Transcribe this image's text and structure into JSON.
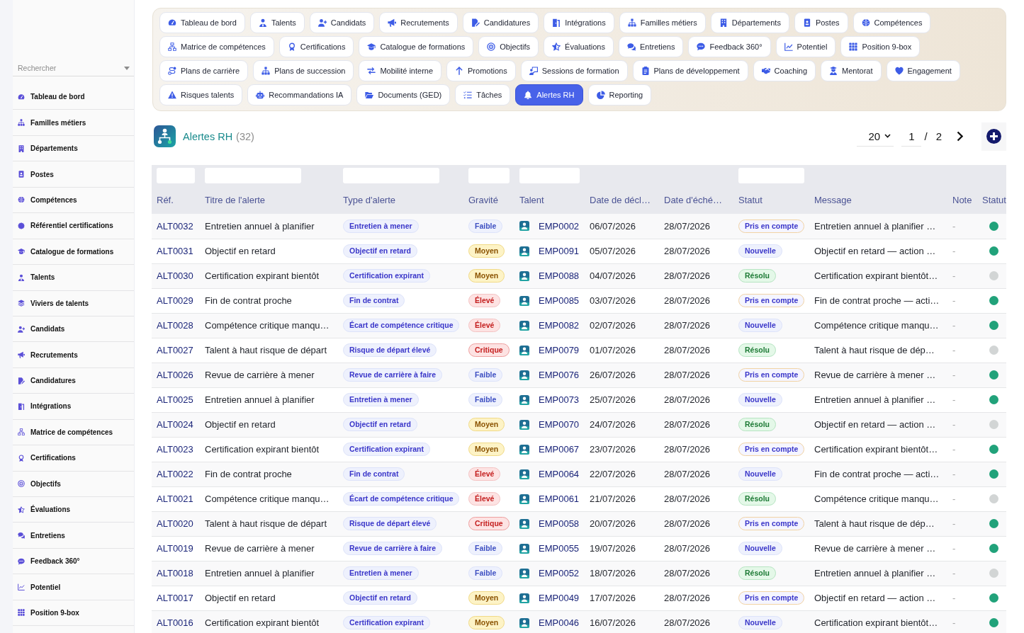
{
  "sidebar": {
    "search": {
      "placeholder": "Rechercher"
    },
    "items": [
      {
        "label": "Tableau de bord"
      },
      {
        "label": "Familles métiers"
      },
      {
        "label": "Départements"
      },
      {
        "label": "Postes"
      },
      {
        "label": "Compétences"
      },
      {
        "label": "Référentiel certifications"
      },
      {
        "label": "Catalogue de formations"
      },
      {
        "label": "Talents"
      },
      {
        "label": "Viviers de talents"
      },
      {
        "label": "Candidats"
      },
      {
        "label": "Recrutements"
      },
      {
        "label": "Candidatures"
      },
      {
        "label": "Intégrations"
      },
      {
        "label": "Matrice de compétences"
      },
      {
        "label": "Certifications"
      },
      {
        "label": "Objectifs"
      },
      {
        "label": "Évaluations"
      },
      {
        "label": "Entretiens"
      },
      {
        "label": "Feedback 360°"
      },
      {
        "label": "Potentiel"
      },
      {
        "label": "Position 9-box"
      }
    ]
  },
  "nav": {
    "rows": [
      {
        "tabs": [
          {
            "label": "Tableau de bord",
            "selected": false
          },
          {
            "label": "Talents",
            "selected": false
          },
          {
            "label": "Candidats",
            "selected": false
          },
          {
            "label": "Recrutements",
            "selected": false
          },
          {
            "label": "Candidatures",
            "selected": false
          },
          {
            "label": "Intégrations",
            "selected": false
          },
          {
            "label": "Familles métiers",
            "selected": false
          },
          {
            "label": "Départements",
            "selected": false
          },
          {
            "label": "Postes",
            "selected": false
          },
          {
            "label": "Compétences",
            "selected": false
          }
        ]
      },
      {
        "tabs": [
          {
            "label": "Matrice de compétences",
            "selected": false
          },
          {
            "label": "Certifications",
            "selected": false
          },
          {
            "label": "Catalogue de formations",
            "selected": false
          },
          {
            "label": "Objectifs",
            "selected": false
          },
          {
            "label": "Évaluations",
            "selected": false
          },
          {
            "label": "Entretiens",
            "selected": false
          },
          {
            "label": "Feedback 360°",
            "selected": false
          },
          {
            "label": "Potentiel",
            "selected": false
          },
          {
            "label": "Position 9-box",
            "selected": false
          }
        ]
      },
      {
        "tabs": [
          {
            "label": "Plans de carrière",
            "selected": false
          },
          {
            "label": "Plans de succession",
            "selected": false
          },
          {
            "label": "Mobilité interne",
            "selected": false
          },
          {
            "label": "Promotions",
            "selected": false
          },
          {
            "label": "Sessions de formation",
            "selected": false
          },
          {
            "label": "Plans de développement",
            "selected": false
          },
          {
            "label": "Coaching",
            "selected": false
          },
          {
            "label": "Mentorat",
            "selected": false
          },
          {
            "label": "Engagement",
            "selected": false
          }
        ]
      },
      {
        "tabs": [
          {
            "label": "Risques talents",
            "selected": false
          },
          {
            "label": "Recommandations IA",
            "selected": false
          },
          {
            "label": "Documents (GED)",
            "selected": false
          },
          {
            "label": "Tâches",
            "selected": false
          },
          {
            "label": "Alertes RH",
            "selected": true
          },
          {
            "label": "Reporting",
            "selected": false
          }
        ]
      }
    ]
  },
  "header": {
    "title": "Alertes RH",
    "count": "(32)",
    "page_size": "20",
    "page": "1",
    "separator": "/",
    "page_count": "2"
  },
  "table": {
    "columns": [
      {
        "label": "Réf.",
        "filter": true
      },
      {
        "label": "Titre de l'alerte",
        "filter": true
      },
      {
        "label": "Type d'alerte",
        "filter": true
      },
      {
        "label": "Gravité",
        "filter": true
      },
      {
        "label": "Talent",
        "filter": true
      },
      {
        "label": "Date de décl…",
        "filter": false
      },
      {
        "label": "Date d'éché…",
        "filter": false
      },
      {
        "label": "Statut",
        "filter": true
      },
      {
        "label": "Message",
        "filter": false
      },
      {
        "label": "Note",
        "filter": false
      },
      {
        "label": "Statut",
        "filter": false
      }
    ],
    "rows": [
      {
        "ref": "ALT0032",
        "title": "Entretien annuel à planifier",
        "type": "Entretien à mener",
        "severity": {
          "text": "Faible",
          "kind": "low"
        },
        "talent": "EMP0002",
        "triggered": "06/07/2026",
        "due": "28/07/2026",
        "status": {
          "text": "Pris en compte",
          "kind": "acknowledged"
        },
        "message": "Entretien annuel à planifier …",
        "note": "-",
        "color": "#21a27a"
      },
      {
        "ref": "ALT0031",
        "title": "Objectif en retard",
        "type": "Objectif en retard",
        "severity": {
          "text": "Moyen",
          "kind": "medium"
        },
        "talent": "EMP0091",
        "triggered": "05/07/2026",
        "due": "28/07/2026",
        "status": {
          "text": "Nouvelle",
          "kind": "new"
        },
        "message": "Objectif en retard — action …",
        "note": "-",
        "color": "#21a27a"
      },
      {
        "ref": "ALT0030",
        "title": "Certification expirant bientôt",
        "type": "Certification expirant",
        "severity": {
          "text": "Moyen",
          "kind": "medium"
        },
        "talent": "EMP0088",
        "triggered": "04/07/2026",
        "due": "28/07/2026",
        "status": {
          "text": "Résolu",
          "kind": "resolved"
        },
        "message": "Certification expirant bientôt…",
        "note": "-",
        "color": "#d2d5d5"
      },
      {
        "ref": "ALT0029",
        "title": "Fin de contrat proche",
        "type": "Fin de contrat",
        "severity": {
          "text": "Élevé",
          "kind": "high"
        },
        "talent": "EMP0085",
        "triggered": "03/07/2026",
        "due": "28/07/2026",
        "status": {
          "text": "Pris en compte",
          "kind": "acknowledged"
        },
        "message": "Fin de contrat proche — acti…",
        "note": "-",
        "color": "#21a27a"
      },
      {
        "ref": "ALT0028",
        "title": "Compétence critique manqu…",
        "type": "Écart de compétence critique",
        "severity": {
          "text": "Élevé",
          "kind": "high"
        },
        "talent": "EMP0082",
        "triggered": "02/07/2026",
        "due": "28/07/2026",
        "status": {
          "text": "Nouvelle",
          "kind": "new"
        },
        "message": "Compétence critique manqu…",
        "note": "-",
        "color": "#21a27a"
      },
      {
        "ref": "ALT0027",
        "title": "Talent à haut risque de départ",
        "type": "Risque de départ élevé",
        "severity": {
          "text": "Critique",
          "kind": "critical"
        },
        "talent": "EMP0079",
        "triggered": "01/07/2026",
        "due": "28/07/2026",
        "status": {
          "text": "Résolu",
          "kind": "resolved"
        },
        "message": "Talent à haut risque de dép…",
        "note": "-",
        "color": "#d2d5d5"
      },
      {
        "ref": "ALT0026",
        "title": "Revue de carrière à mener",
        "type": "Revue de carrière à faire",
        "severity": {
          "text": "Faible",
          "kind": "low"
        },
        "talent": "EMP0076",
        "triggered": "26/07/2026",
        "due": "28/07/2026",
        "status": {
          "text": "Pris en compte",
          "kind": "acknowledged"
        },
        "message": "Revue de carrière à mener …",
        "note": "-",
        "color": "#21a27a"
      },
      {
        "ref": "ALT0025",
        "title": "Entretien annuel à planifier",
        "type": "Entretien à mener",
        "severity": {
          "text": "Faible",
          "kind": "low"
        },
        "talent": "EMP0073",
        "triggered": "25/07/2026",
        "due": "28/07/2026",
        "status": {
          "text": "Nouvelle",
          "kind": "new"
        },
        "message": "Entretien annuel à planifier …",
        "note": "-",
        "color": "#21a27a"
      },
      {
        "ref": "ALT0024",
        "title": "Objectif en retard",
        "type": "Objectif en retard",
        "severity": {
          "text": "Moyen",
          "kind": "medium"
        },
        "talent": "EMP0070",
        "triggered": "24/07/2026",
        "due": "28/07/2026",
        "status": {
          "text": "Résolu",
          "kind": "resolved"
        },
        "message": "Objectif en retard — action …",
        "note": "-",
        "color": "#d2d5d5"
      },
      {
        "ref": "ALT0023",
        "title": "Certification expirant bientôt",
        "type": "Certification expirant",
        "severity": {
          "text": "Moyen",
          "kind": "medium"
        },
        "talent": "EMP0067",
        "triggered": "23/07/2026",
        "due": "28/07/2026",
        "status": {
          "text": "Pris en compte",
          "kind": "acknowledged"
        },
        "message": "Certification expirant bientôt…",
        "note": "-",
        "color": "#21a27a"
      },
      {
        "ref": "ALT0022",
        "title": "Fin de contrat proche",
        "type": "Fin de contrat",
        "severity": {
          "text": "Élevé",
          "kind": "high"
        },
        "talent": "EMP0064",
        "triggered": "22/07/2026",
        "due": "28/07/2026",
        "status": {
          "text": "Nouvelle",
          "kind": "new"
        },
        "message": "Fin de contrat proche — acti…",
        "note": "-",
        "color": "#21a27a"
      },
      {
        "ref": "ALT0021",
        "title": "Compétence critique manqu…",
        "type": "Écart de compétence critique",
        "severity": {
          "text": "Élevé",
          "kind": "high"
        },
        "talent": "EMP0061",
        "triggered": "21/07/2026",
        "due": "28/07/2026",
        "status": {
          "text": "Résolu",
          "kind": "resolved"
        },
        "message": "Compétence critique manqu…",
        "note": "-",
        "color": "#d2d5d5"
      },
      {
        "ref": "ALT0020",
        "title": "Talent à haut risque de départ",
        "type": "Risque de départ élevé",
        "severity": {
          "text": "Critique",
          "kind": "critical"
        },
        "talent": "EMP0058",
        "triggered": "20/07/2026",
        "due": "28/07/2026",
        "status": {
          "text": "Pris en compte",
          "kind": "acknowledged"
        },
        "message": "Talent à haut risque de dép…",
        "note": "-",
        "color": "#21a27a"
      },
      {
        "ref": "ALT0019",
        "title": "Revue de carrière à mener",
        "type": "Revue de carrière à faire",
        "severity": {
          "text": "Faible",
          "kind": "low"
        },
        "talent": "EMP0055",
        "triggered": "19/07/2026",
        "due": "28/07/2026",
        "status": {
          "text": "Nouvelle",
          "kind": "new"
        },
        "message": "Revue de carrière à mener …",
        "note": "-",
        "color": "#21a27a"
      },
      {
        "ref": "ALT0018",
        "title": "Entretien annuel à planifier",
        "type": "Entretien à mener",
        "severity": {
          "text": "Faible",
          "kind": "low"
        },
        "talent": "EMP0052",
        "triggered": "18/07/2026",
        "due": "28/07/2026",
        "status": {
          "text": "Résolu",
          "kind": "resolved"
        },
        "message": "Entretien annuel à planifier …",
        "note": "-",
        "color": "#d2d5d5"
      },
      {
        "ref": "ALT0017",
        "title": "Objectif en retard",
        "type": "Objectif en retard",
        "severity": {
          "text": "Moyen",
          "kind": "medium"
        },
        "talent": "EMP0049",
        "triggered": "17/07/2026",
        "due": "28/07/2026",
        "status": {
          "text": "Pris en compte",
          "kind": "acknowledged"
        },
        "message": "Objectif en retard — action …",
        "note": "-",
        "color": "#21a27a"
      },
      {
        "ref": "ALT0016",
        "title": "Certification expirant bientôt",
        "type": "Certification expirant",
        "severity": {
          "text": "Moyen",
          "kind": "medium"
        },
        "talent": "EMP0046",
        "triggered": "16/07/2026",
        "due": "28/07/2026",
        "status": {
          "text": "Nouvelle",
          "kind": "new"
        },
        "message": "Certification expirant bientôt…",
        "note": "-",
        "color": "#21a27a"
      }
    ]
  }
}
